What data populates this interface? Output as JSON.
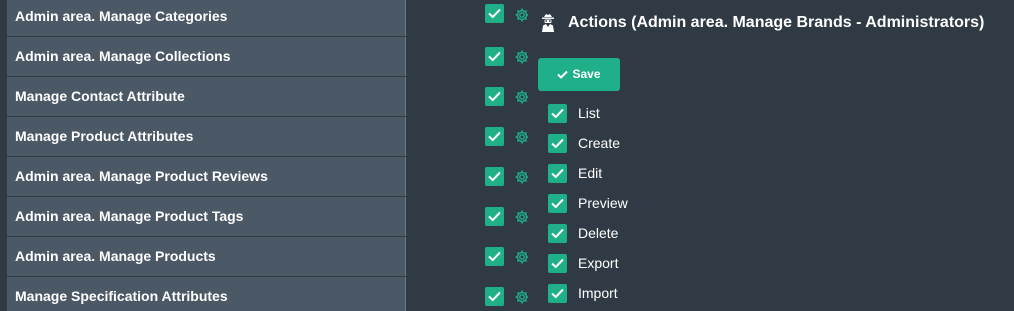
{
  "permissions": [
    {
      "label": "Admin area. Manage Categories",
      "checked": true
    },
    {
      "label": "Admin area. Manage Collections",
      "checked": true
    },
    {
      "label": "Manage Contact Attribute",
      "checked": true
    },
    {
      "label": "Manage Product Attributes",
      "checked": true
    },
    {
      "label": "Admin area. Manage Product Reviews",
      "checked": true
    },
    {
      "label": "Admin area. Manage Product Tags",
      "checked": true
    },
    {
      "label": "Admin area. Manage Products",
      "checked": true
    },
    {
      "label": "Manage Specification Attributes",
      "checked": true
    }
  ],
  "actions_panel": {
    "title": "Actions (Admin area. Manage Brands - Administrators)",
    "title_icon": "user-secret-icon",
    "save_label": "Save",
    "items": [
      {
        "label": "List",
        "checked": true
      },
      {
        "label": "Create",
        "checked": true
      },
      {
        "label": "Edit",
        "checked": true
      },
      {
        "label": "Preview",
        "checked": true
      },
      {
        "label": "Delete",
        "checked": true
      },
      {
        "label": "Export",
        "checked": true
      },
      {
        "label": "Import",
        "checked": true
      }
    ]
  },
  "colors": {
    "accent": "#1fb08a",
    "row_bg": "#4b5866",
    "panel_bg": "#2f3a45",
    "gear": "#1fb08a"
  }
}
